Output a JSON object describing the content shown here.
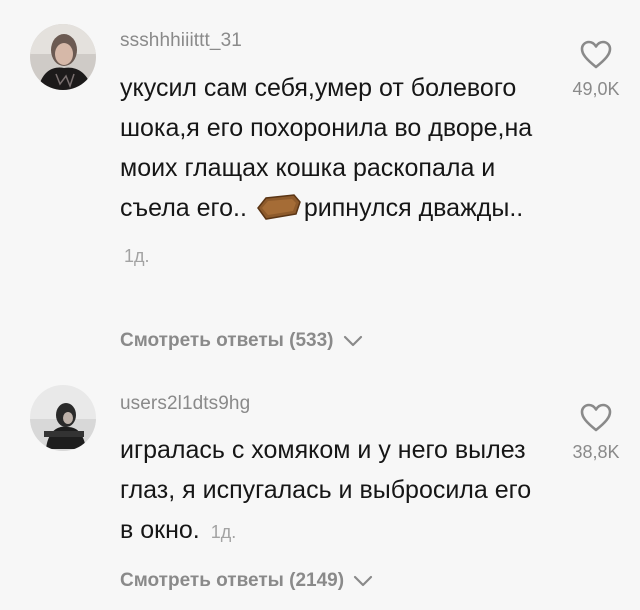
{
  "comments": [
    {
      "username": "ssshhhiiittt_31",
      "text_before": "укусил сам себя,умер от болевого шока,я его похоронила во дворе,на моих глащах кошка раскопала и съела его..",
      "emoji": "coffin-emoji",
      "text_after": "рипнулся дважды..",
      "time": "1д.",
      "likes": "49,0K",
      "replies": "Смотреть ответы (533)"
    },
    {
      "username": "users2l1dts9hg",
      "text_before": "игралась с хомяком и у него вылез глаз, я испугалась и выбросила его в окно.",
      "time": "1д.",
      "likes": "38,8K",
      "replies": "Смотреть ответы (2149)"
    }
  ],
  "icons": {
    "like": "heart-outline-icon",
    "expand": "chevron-down-icon"
  },
  "colors": {
    "background": "#f7f7f7",
    "text": "#161616",
    "secondary": "#8a8a8a"
  }
}
